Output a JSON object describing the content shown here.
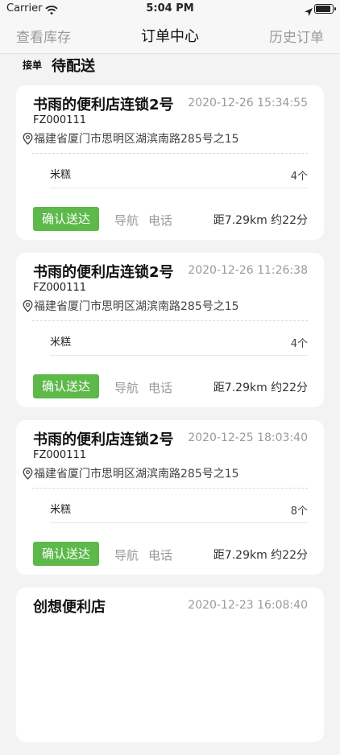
{
  "status_bar": {
    "carrier": "Carrier",
    "time": "5:04 PM"
  },
  "nav": {
    "left": "查看库存",
    "title": "订单中心",
    "right": "历史订单"
  },
  "section": {
    "tag": "接单",
    "label": "待配送"
  },
  "colors": {
    "accent_green": "#5db94a",
    "muted_text": "#9a9a9a",
    "background": "#f3f3f3"
  },
  "orders": [
    {
      "shop": "书雨的便利店连锁2号",
      "time": "2020-12-26 15:34:55",
      "code": "FZ000111",
      "address": "福建省厦门市思明区湖滨南路285号之15",
      "item": "米糕",
      "qty": "4个",
      "confirm": "确认送达",
      "navigate": "导航",
      "phone": "电话",
      "distance": "距7.29km 约22分"
    },
    {
      "shop": "书雨的便利店连锁2号",
      "time": "2020-12-26 11:26:38",
      "code": "FZ000111",
      "address": "福建省厦门市思明区湖滨南路285号之15",
      "item": "米糕",
      "qty": "4个",
      "confirm": "确认送达",
      "navigate": "导航",
      "phone": "电话",
      "distance": "距7.29km 约22分"
    },
    {
      "shop": "书雨的便利店连锁2号",
      "time": "2020-12-25 18:03:40",
      "code": "FZ000111",
      "address": "福建省厦门市思明区湖滨南路285号之15",
      "item": "米糕",
      "qty": "8个",
      "confirm": "确认送达",
      "navigate": "导航",
      "phone": "电话",
      "distance": "距7.29km 约22分"
    },
    {
      "shop": "创想便利店",
      "time": "2020-12-23 16:08:40"
    }
  ]
}
